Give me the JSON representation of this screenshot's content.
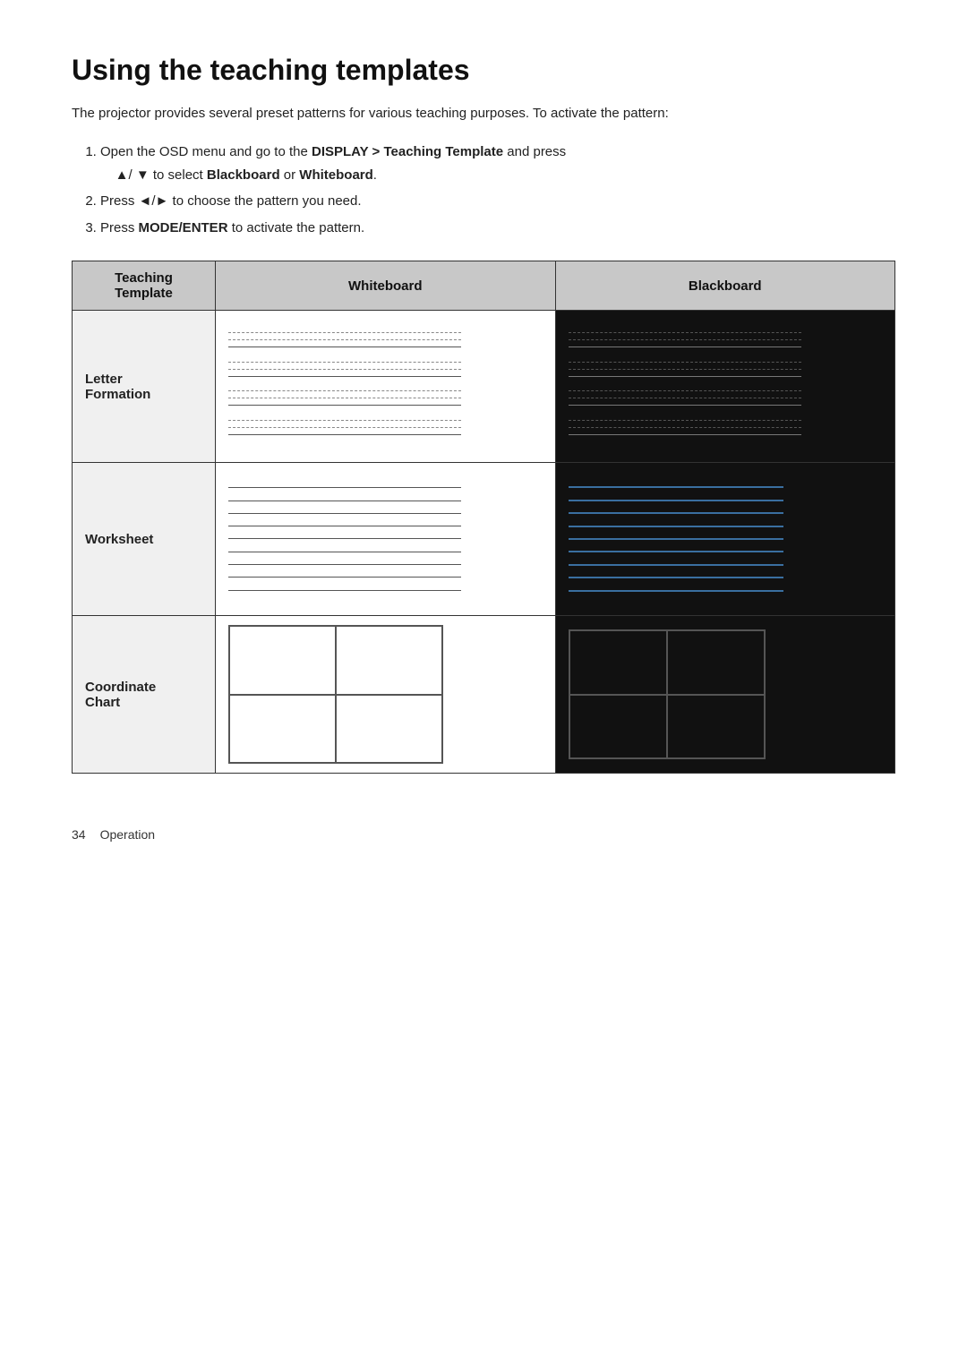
{
  "page": {
    "title": "Using the teaching templates",
    "intro": "The projector provides several preset patterns for various teaching purposes. To activate the pattern:",
    "steps": [
      {
        "id": 1,
        "text_parts": [
          {
            "text": "Open the OSD menu and go to the ",
            "bold": false
          },
          {
            "text": "DISPLAY > Teaching Template",
            "bold": true
          },
          {
            "text": " and press ▲/ ▼ to select ",
            "bold": false
          },
          {
            "text": "Blackboard",
            "bold": true
          },
          {
            "text": " or ",
            "bold": false
          },
          {
            "text": "Whiteboard",
            "bold": true
          },
          {
            "text": ".",
            "bold": false
          }
        ]
      },
      {
        "id": 2,
        "text_parts": [
          {
            "text": "Press ◄/► to choose the pattern you need.",
            "bold": false
          }
        ]
      },
      {
        "id": 3,
        "text_parts": [
          {
            "text": "Press ",
            "bold": false
          },
          {
            "text": "MODE/ENTER",
            "bold": true
          },
          {
            "text": " to activate the pattern.",
            "bold": false
          }
        ]
      }
    ],
    "table": {
      "headers": [
        "Teaching Template",
        "Whiteboard",
        "Blackboard"
      ],
      "rows": [
        {
          "label": "Letter Formation",
          "whiteboard_type": "letter-formation-white",
          "blackboard_type": "letter-formation-black"
        },
        {
          "label": "Worksheet",
          "whiteboard_type": "worksheet-white",
          "blackboard_type": "worksheet-black"
        },
        {
          "label": "Coordinate Chart",
          "whiteboard_type": "coord-chart-white",
          "blackboard_type": "coord-chart-black"
        }
      ]
    },
    "footer": {
      "page_number": "34",
      "section": "Operation"
    }
  }
}
